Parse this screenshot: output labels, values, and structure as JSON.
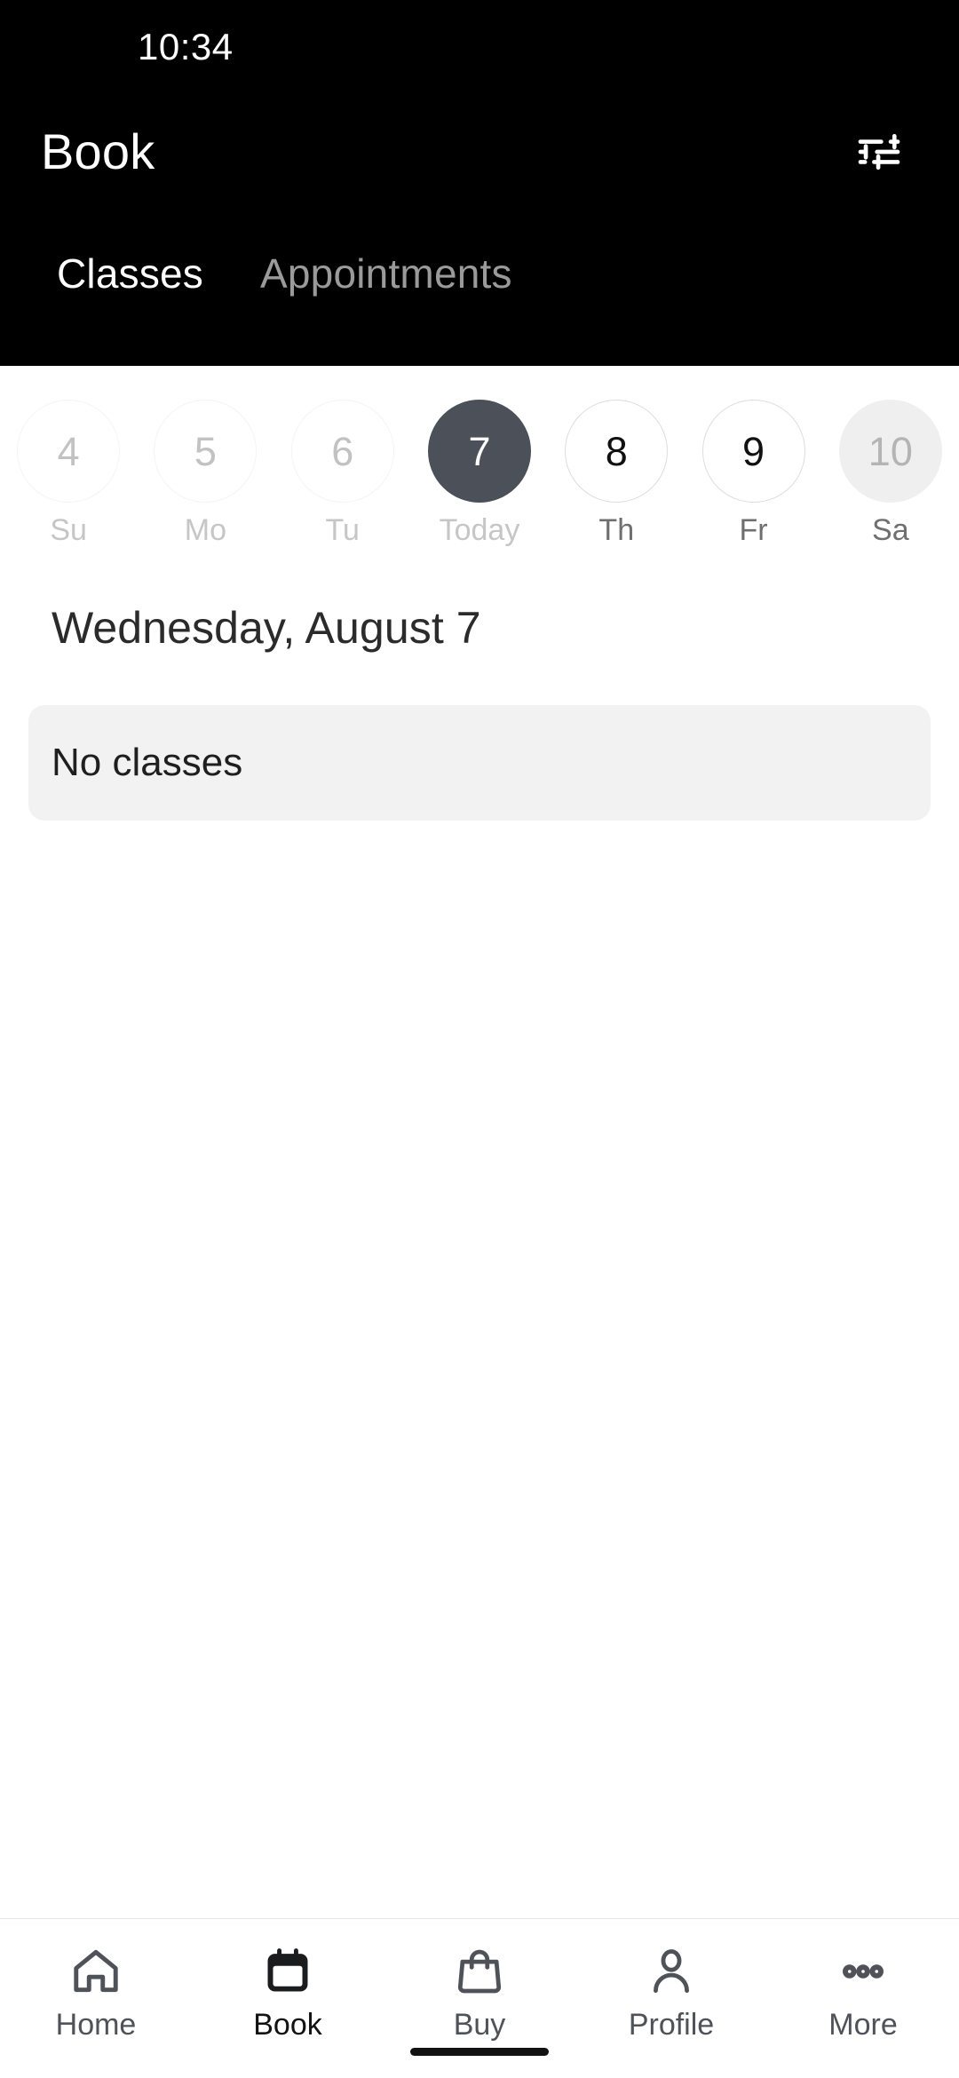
{
  "status_bar": {
    "time": "10:34"
  },
  "header": {
    "title": "Book",
    "filter_icon": "sliders-filter-icon",
    "tabs": [
      {
        "label": "Classes",
        "active": true
      },
      {
        "label": "Appointments",
        "active": false
      }
    ]
  },
  "date_strip": [
    {
      "day_number": "4",
      "weekday": "Su",
      "state": "past"
    },
    {
      "day_number": "5",
      "weekday": "Mo",
      "state": "past"
    },
    {
      "day_number": "6",
      "weekday": "Tu",
      "state": "past"
    },
    {
      "day_number": "7",
      "weekday": "Today",
      "state": "selected"
    },
    {
      "day_number": "8",
      "weekday": "Th",
      "state": "future"
    },
    {
      "day_number": "9",
      "weekday": "Fr",
      "state": "future"
    },
    {
      "day_number": "10",
      "weekday": "Sa",
      "state": "muted-fill"
    }
  ],
  "main": {
    "day_heading": "Wednesday, August 7",
    "empty_state_text": "No classes"
  },
  "bottom_nav": [
    {
      "label": "Home",
      "icon": "home-icon",
      "active": false
    },
    {
      "label": "Book",
      "icon": "calendar-icon",
      "active": true
    },
    {
      "label": "Buy",
      "icon": "shopping-bag-icon",
      "active": false
    },
    {
      "label": "Profile",
      "icon": "person-icon",
      "active": false
    },
    {
      "label": "More",
      "icon": "more-dots-icon",
      "active": false
    }
  ],
  "colors": {
    "header_bg": "#000000",
    "selected_day": "#4b5059",
    "card_bg": "#f2f2f2",
    "accent_text": "#ffffff",
    "nav_icon": "#4f5258"
  }
}
